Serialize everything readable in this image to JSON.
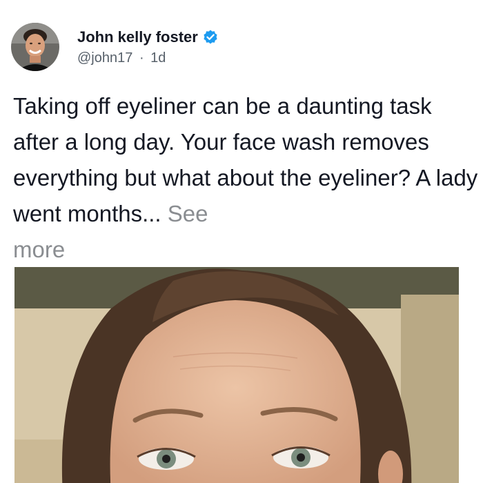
{
  "post": {
    "author_name": "John kelly foster",
    "verified_icon": "verified-badge-icon",
    "handle": "@john17",
    "separator": "·",
    "time_ago": "1d",
    "text": "Taking off eyeliner can be a daunting task after a long day. Your face wash removes everything but what about the eyeliner? A lady went months...",
    "see_more_line1": "See",
    "see_more_line2": "more"
  },
  "colors": {
    "verified_blue": "#1d9bf0",
    "text_primary": "#141823",
    "text_secondary": "#57606a",
    "link_gray": "#8a8d91"
  }
}
